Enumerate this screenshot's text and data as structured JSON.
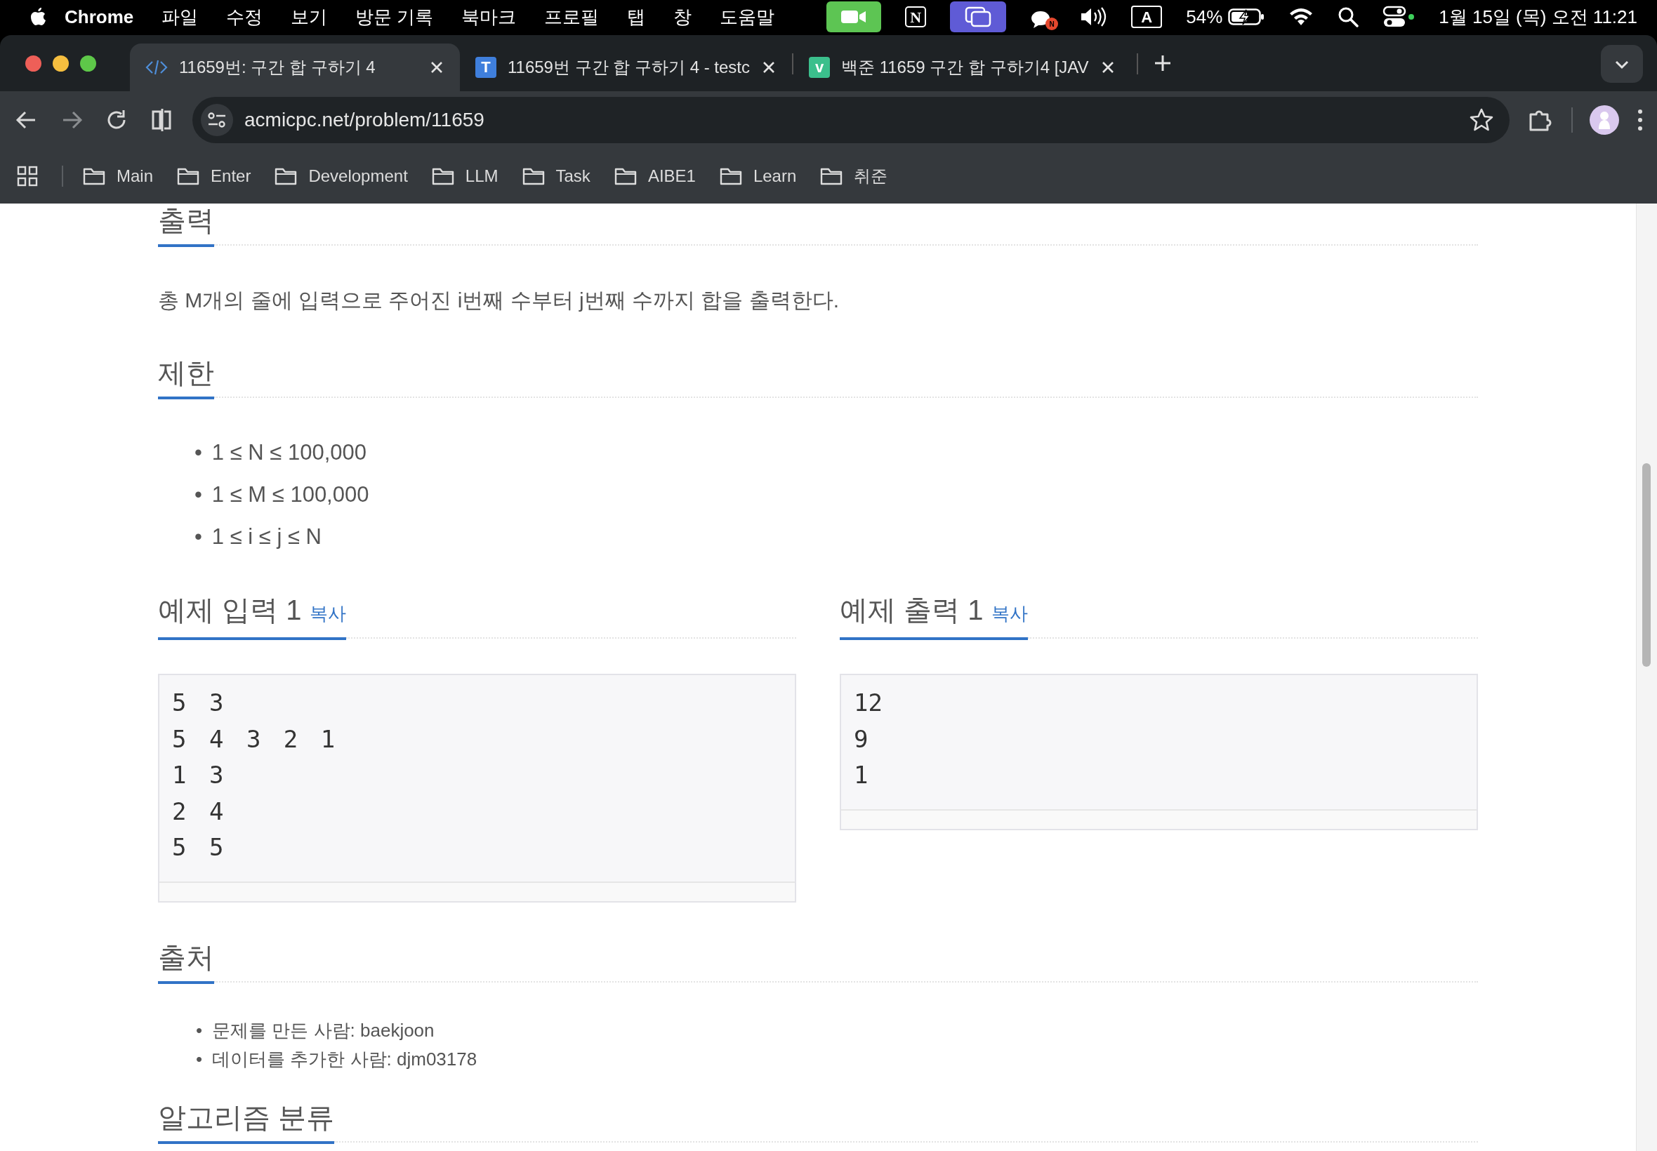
{
  "menu_bar": {
    "app": "Chrome",
    "items": [
      "파일",
      "수정",
      "보기",
      "방문 기록",
      "북마크",
      "프로필",
      "탭",
      "창",
      "도움말"
    ],
    "status_icons": [
      {
        "kind": "facetime"
      },
      {
        "kind": "notion",
        "label": "N"
      },
      {
        "kind": "screens"
      },
      {
        "kind": "chat",
        "label": "N"
      },
      {
        "kind": "volume"
      },
      {
        "kind": "input",
        "label": "A"
      },
      {
        "kind": "battery",
        "label": "54%"
      },
      {
        "kind": "wifi"
      },
      {
        "kind": "search"
      },
      {
        "kind": "control"
      }
    ],
    "clock": "1월 15일 (목) 오전 11:21"
  },
  "tabs": [
    {
      "title": "11659번: 구간 합 구하기 4",
      "selected": true,
      "favicon": {
        "kind": "code"
      }
    },
    {
      "title": "11659번 구간 합 구하기 4 - testc",
      "selected": false,
      "favicon": {
        "kind": "letter",
        "label": "T",
        "color": "#3f7fdc"
      }
    },
    {
      "title": "백준 11659 구간 합 구하기4 [JAV",
      "selected": false,
      "favicon": {
        "kind": "letter",
        "label": "v",
        "color": "#3bbf8c"
      }
    }
  ],
  "address": "acmicpc.net/problem/11659",
  "bookmarks": [
    "Main",
    "Enter",
    "Development",
    "LLM",
    "Task",
    "AIBE1",
    "Learn",
    "취준"
  ],
  "problem": {
    "output": {
      "heading": "출력",
      "text": "총 M개의 줄에 입력으로 주어진 i번째 수부터 j번째 수까지 합을 출력한다."
    },
    "limits": {
      "heading": "제한",
      "bullet": "•",
      "items": [
        "1 ≤ N ≤ 100,000",
        "1 ≤ M ≤ 100,000",
        "1 ≤ i ≤ j ≤ N"
      ]
    },
    "samples": [
      {
        "heading": "예제 입력 1",
        "copy": "복사",
        "lines": [
          "5 3",
          "5 4 3 2 1",
          "1 3",
          "2 4",
          "5 5"
        ]
      },
      {
        "heading": "예제 출력 1",
        "copy": "복사",
        "lines": [
          "12",
          "9",
          "1"
        ]
      }
    ],
    "source": {
      "heading": "출처",
      "bullet": "•",
      "items": [
        "문제를 만든 사람: baekjoon",
        "데이터를 추가한 사람: djm03178"
      ]
    },
    "algorithm_heading": "알고리즘 분류"
  }
}
